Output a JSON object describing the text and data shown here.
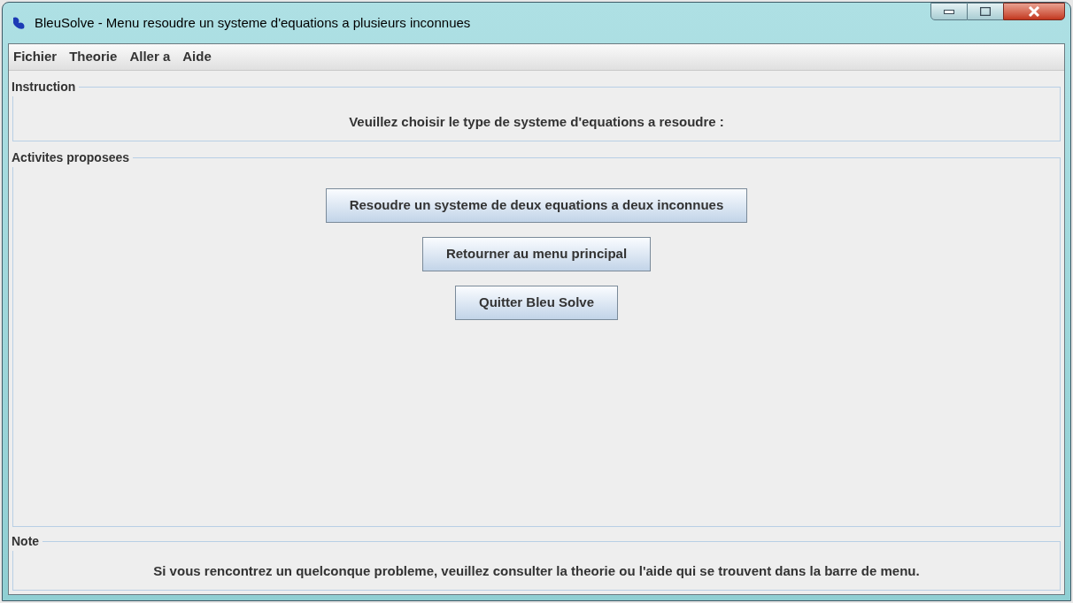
{
  "window": {
    "title": "BleuSolve - Menu resoudre un systeme d'equations a plusieurs inconnues"
  },
  "menu": [
    "Fichier",
    "Theorie",
    "Aller a",
    "Aide"
  ],
  "instruction": {
    "title": "Instruction",
    "text": "Veuillez choisir le type de systeme d'equations a resoudre :"
  },
  "activities": {
    "title": "Activites proposees",
    "buttons": [
      "Resoudre un systeme de deux equations a deux inconnues",
      "Retourner au menu principal",
      "Quitter Bleu Solve"
    ]
  },
  "note": {
    "title": "Note",
    "text": "Si vous rencontrez un quelconque probleme, veuillez consulter la theorie ou l'aide qui se trouvent dans la barre de menu."
  }
}
